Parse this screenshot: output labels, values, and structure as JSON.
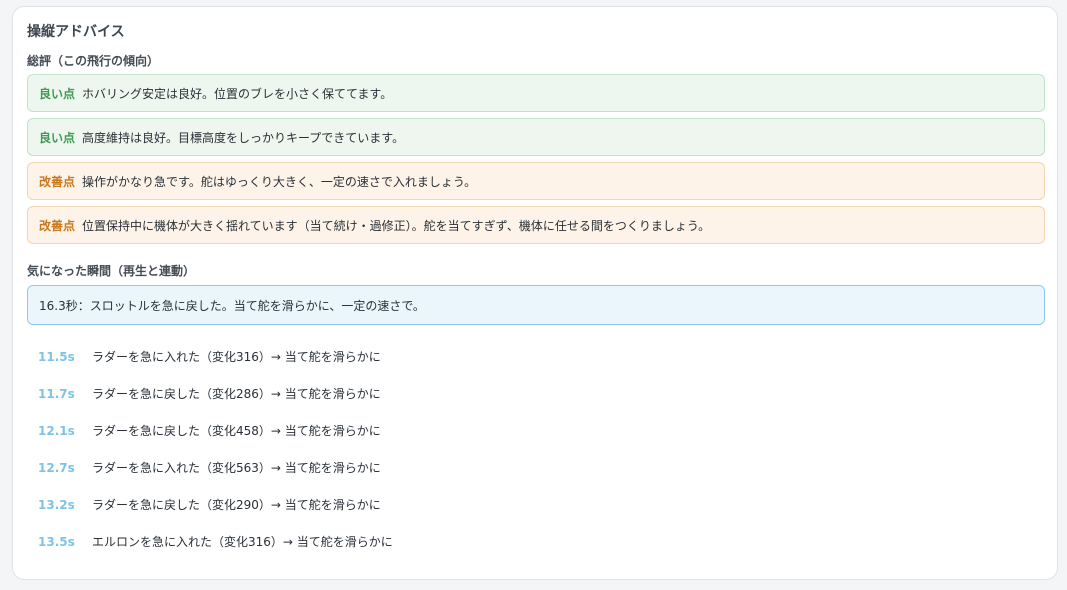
{
  "panel": {
    "title": "操縦アドバイス"
  },
  "summary": {
    "title": "総評（この飛行の傾向）",
    "items": [
      {
        "tag": "良い点",
        "text": "ホバリング安定は良好。位置のブレを小さく保ててます。"
      },
      {
        "tag": "良い点",
        "text": "高度維持は良好。目標高度をしっかりキープできています。"
      },
      {
        "tag": "改善点",
        "text": "操作がかなり急です。舵はゆっくり大きく、一定の速さで入れましょう。"
      },
      {
        "tag": "改善点",
        "text": "位置保持中に機体が大きく揺れています（当て続け・過修正）。舵を当てすぎず、機体に任せる間をつくりましょう。"
      }
    ]
  },
  "moments": {
    "title": "気になった瞬間（再生と連動）",
    "current": "16.3秒：スロットルを急に戻した。当て舵を滑らかに、一定の速さで。",
    "items": [
      {
        "time": "11.5s",
        "text": "ラダーを急に入れた（変化316）→ 当て舵を滑らかに"
      },
      {
        "time": "11.7s",
        "text": "ラダーを急に戻した（変化286）→ 当て舵を滑らかに"
      },
      {
        "time": "12.1s",
        "text": "ラダーを急に戻した（変化458）→ 当て舵を滑らかに"
      },
      {
        "time": "12.7s",
        "text": "ラダーを急に入れた（変化563）→ 当て舵を滑らかに"
      },
      {
        "time": "13.2s",
        "text": "ラダーを急に戻した（変化290）→ 当て舵を滑らかに"
      },
      {
        "time": "13.5s",
        "text": "エルロンを急に入れた（変化316）→ 当て舵を滑らかに"
      }
    ]
  },
  "colors": {
    "good": "#3e9a55",
    "improve": "#c9781f",
    "time": "#7cc3e6",
    "highlight_border": "#8fcbe8"
  }
}
